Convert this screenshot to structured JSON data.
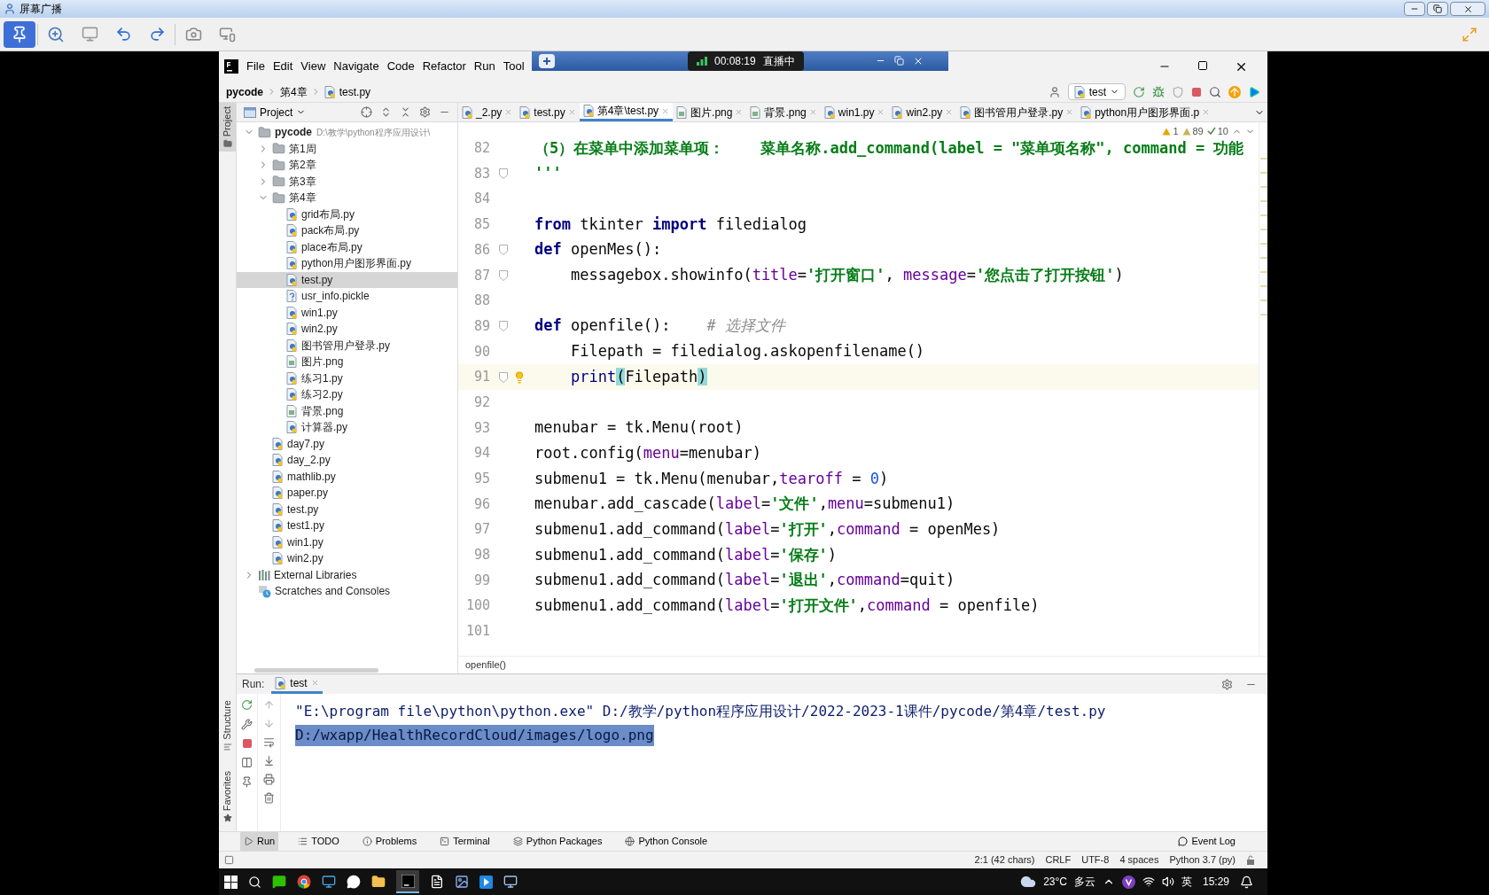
{
  "screen_title": "屏幕广播",
  "broadcast_overlay": {
    "timer": "00:08:19",
    "status": "直播中"
  },
  "ide": {
    "menu": [
      "File",
      "Edit",
      "View",
      "Navigate",
      "Code",
      "Refactor",
      "Run",
      "Tool"
    ],
    "breadcrumbs": [
      "pycode",
      "第4章",
      "test.py"
    ],
    "run_config": "test",
    "side_labels": [
      "Project",
      "Structure",
      "Favorites"
    ],
    "project_panel": {
      "title": "Project",
      "tree": [
        {
          "label": "pycode",
          "kind": "folder",
          "path": "D:\\教学\\python程序应用设计\\",
          "expanded": true,
          "selected": false,
          "children": [
            {
              "label": "第1周",
              "kind": "folder",
              "expanded": false,
              "selected": false
            },
            {
              "label": "第2章",
              "kind": "folder",
              "expanded": false,
              "selected": false
            },
            {
              "label": "第3章",
              "kind": "folder",
              "expanded": false,
              "selected": false
            },
            {
              "label": "第4章",
              "kind": "folder",
              "expanded": true,
              "selected": false,
              "children": [
                {
                  "label": "grid布局.py",
                  "kind": "python",
                  "selected": false
                },
                {
                  "label": "pack布局.py",
                  "kind": "python",
                  "selected": false
                },
                {
                  "label": "place布局.py",
                  "kind": "python",
                  "selected": false
                },
                {
                  "label": "python用户图形界面.py",
                  "kind": "python",
                  "selected": false
                },
                {
                  "label": "test.py",
                  "kind": "python",
                  "selected": true
                },
                {
                  "label": "usr_info.pickle",
                  "kind": "unknown",
                  "selected": false
                },
                {
                  "label": "win1.py",
                  "kind": "python",
                  "selected": false
                },
                {
                  "label": "win2.py",
                  "kind": "python",
                  "selected": false
                },
                {
                  "label": "图书管用户登录.py",
                  "kind": "python",
                  "selected": false
                },
                {
                  "label": "图片.png",
                  "kind": "image",
                  "selected": false
                },
                {
                  "label": "练习1.py",
                  "kind": "python",
                  "selected": false
                },
                {
                  "label": "练习2.py",
                  "kind": "python",
                  "selected": false
                },
                {
                  "label": "背景.png",
                  "kind": "image",
                  "selected": false
                },
                {
                  "label": "计算器.py",
                  "kind": "python",
                  "selected": false
                }
              ]
            },
            {
              "label": "day7.py",
              "kind": "python",
              "selected": false
            },
            {
              "label": "day_2.py",
              "kind": "python",
              "selected": false
            },
            {
              "label": "mathlib.py",
              "kind": "python",
              "selected": false
            },
            {
              "label": "paper.py",
              "kind": "python",
              "selected": false
            },
            {
              "label": "test.py",
              "kind": "python",
              "selected": false
            },
            {
              "label": "test1.py",
              "kind": "python",
              "selected": false
            },
            {
              "label": "win1.py",
              "kind": "python",
              "selected": false
            },
            {
              "label": "win2.py",
              "kind": "python",
              "selected": false
            }
          ]
        },
        {
          "label": "External Libraries",
          "kind": "library",
          "expanded": false,
          "selected": false
        },
        {
          "label": "Scratches and Consoles",
          "kind": "scratches",
          "selected": false
        }
      ]
    },
    "editor_tabs": [
      {
        "label": "_2.py",
        "kind": "python",
        "selected": false
      },
      {
        "label": "test.py",
        "kind": "python",
        "selected": false
      },
      {
        "label": "第4章\\test.py",
        "kind": "python",
        "selected": true
      },
      {
        "label": "图片.png",
        "kind": "image",
        "selected": false
      },
      {
        "label": "背景.png",
        "kind": "image",
        "selected": false
      },
      {
        "label": "win1.py",
        "kind": "python",
        "selected": false
      },
      {
        "label": "win2.py",
        "kind": "python",
        "selected": false
      },
      {
        "label": "图书管用户登录.py",
        "kind": "python",
        "selected": false
      },
      {
        "label": "python用户图形界面.p",
        "kind": "python",
        "selected": false
      }
    ],
    "inspections": [
      {
        "kind": "warning",
        "count": "1"
      },
      {
        "kind": "weak_warning",
        "count": "89"
      },
      {
        "kind": "typo",
        "count": "10"
      }
    ],
    "code_lines": [
      {
        "number": "82",
        "current": false,
        "fold": false,
        "bulb": false,
        "tokens": [
          {
            "kind": "docstring",
            "text": "（5）在菜单中添加菜单项：    菜单名称.add_command(label = \"菜单项名称\", command = 功能"
          }
        ]
      },
      {
        "number": "83",
        "current": false,
        "fold": true,
        "bulb": false,
        "tokens": [
          {
            "kind": "docstring",
            "text": "'''"
          }
        ]
      },
      {
        "number": "84",
        "current": false,
        "fold": false,
        "bulb": false
      },
      {
        "number": "85",
        "current": false,
        "fold": false,
        "bulb": false,
        "tokens": [
          {
            "kind": "keyword",
            "text": "from"
          },
          {
            "kind": "plain",
            "text": " tkinter "
          },
          {
            "kind": "keyword",
            "text": "import"
          },
          {
            "kind": "plain",
            "text": " filedialog"
          }
        ]
      },
      {
        "number": "86",
        "current": false,
        "fold": true,
        "bulb": false,
        "tokens": [
          {
            "kind": "keyword",
            "text": "def"
          },
          {
            "kind": "plain",
            "text": " openMes():"
          }
        ]
      },
      {
        "number": "87",
        "current": false,
        "fold": true,
        "bulb": false,
        "tokens": [
          {
            "kind": "plain",
            "text": "    messagebox.showinfo("
          },
          {
            "kind": "param",
            "text": "title"
          },
          {
            "kind": "plain",
            "text": "="
          },
          {
            "kind": "string",
            "text": "'打开窗口'"
          },
          {
            "kind": "plain",
            "text": ", "
          },
          {
            "kind": "param",
            "text": "message"
          },
          {
            "kind": "plain",
            "text": "="
          },
          {
            "kind": "string",
            "text": "'您点击了打开按钮'"
          },
          {
            "kind": "plain",
            "text": ")"
          }
        ]
      },
      {
        "number": "88",
        "current": false,
        "fold": false,
        "bulb": false
      },
      {
        "number": "89",
        "current": false,
        "fold": true,
        "bulb": false,
        "tokens": [
          {
            "kind": "keyword",
            "text": "def"
          },
          {
            "kind": "plain",
            "text": " openfile():    "
          },
          {
            "kind": "comment",
            "text": "# 选择文件"
          }
        ]
      },
      {
        "number": "90",
        "current": false,
        "fold": false,
        "bulb": false,
        "tokens": [
          {
            "kind": "plain",
            "text": "    Filepath = filedialog.askopenfilename()"
          }
        ]
      },
      {
        "number": "91",
        "current": true,
        "fold": true,
        "bulb": true,
        "tokens": [
          {
            "kind": "builtin",
            "text": "    print"
          },
          {
            "kind": "brace_match",
            "text": "("
          },
          {
            "kind": "plain",
            "text": "Filepath"
          },
          {
            "kind": "brace_match",
            "text": ")"
          }
        ]
      },
      {
        "number": "92",
        "current": false,
        "fold": false,
        "bulb": false
      },
      {
        "number": "93",
        "current": false,
        "fold": false,
        "bulb": false,
        "tokens": [
          {
            "kind": "plain",
            "text": "menubar = tk.Menu(root)"
          }
        ]
      },
      {
        "number": "94",
        "current": false,
        "fold": false,
        "bulb": false,
        "tokens": [
          {
            "kind": "plain",
            "text": "root.config("
          },
          {
            "kind": "param",
            "text": "menu"
          },
          {
            "kind": "plain",
            "text": "=menubar)"
          }
        ]
      },
      {
        "number": "95",
        "current": false,
        "fold": false,
        "bulb": false,
        "tokens": [
          {
            "kind": "plain",
            "text": "submenu1 = tk.Menu(menubar,"
          },
          {
            "kind": "param",
            "text": "tearoff"
          },
          {
            "kind": "plain",
            "text": " = "
          },
          {
            "kind": "number",
            "text": "0"
          },
          {
            "kind": "plain",
            "text": ")"
          }
        ]
      },
      {
        "number": "96",
        "current": false,
        "fold": false,
        "bulb": false,
        "tokens": [
          {
            "kind": "plain",
            "text": "menubar.add_cascade("
          },
          {
            "kind": "param",
            "text": "label"
          },
          {
            "kind": "plain",
            "text": "="
          },
          {
            "kind": "string",
            "text": "'文件'"
          },
          {
            "kind": "plain",
            "text": ","
          },
          {
            "kind": "param",
            "text": "menu"
          },
          {
            "kind": "plain",
            "text": "=submenu1)"
          }
        ]
      },
      {
        "number": "97",
        "current": false,
        "fold": false,
        "bulb": false,
        "tokens": [
          {
            "kind": "plain",
            "text": "submenu1.add_command("
          },
          {
            "kind": "param",
            "text": "label"
          },
          {
            "kind": "plain",
            "text": "="
          },
          {
            "kind": "string",
            "text": "'打开'"
          },
          {
            "kind": "plain",
            "text": ","
          },
          {
            "kind": "param",
            "text": "command"
          },
          {
            "kind": "plain",
            "text": " = openMes)"
          }
        ]
      },
      {
        "number": "98",
        "current": false,
        "fold": false,
        "bulb": false,
        "tokens": [
          {
            "kind": "plain",
            "text": "submenu1.add_command("
          },
          {
            "kind": "param",
            "text": "label"
          },
          {
            "kind": "plain",
            "text": "="
          },
          {
            "kind": "string",
            "text": "'保存'"
          },
          {
            "kind": "plain",
            "text": ")"
          }
        ]
      },
      {
        "number": "99",
        "current": false,
        "fold": false,
        "bulb": false,
        "tokens": [
          {
            "kind": "plain",
            "text": "submenu1.add_command("
          },
          {
            "kind": "param",
            "text": "label"
          },
          {
            "kind": "plain",
            "text": "="
          },
          {
            "kind": "string",
            "text": "'退出'"
          },
          {
            "kind": "plain",
            "text": ","
          },
          {
            "kind": "param",
            "text": "command"
          },
          {
            "kind": "plain",
            "text": "=quit)"
          }
        ]
      },
      {
        "number": "100",
        "current": false,
        "fold": false,
        "bulb": false,
        "tokens": [
          {
            "kind": "plain",
            "text": "submenu1.add_command("
          },
          {
            "kind": "param",
            "text": "label"
          },
          {
            "kind": "plain",
            "text": "="
          },
          {
            "kind": "string",
            "text": "'打开文件'"
          },
          {
            "kind": "plain",
            "text": ","
          },
          {
            "kind": "param",
            "text": "command"
          },
          {
            "kind": "plain",
            "text": " = openfile)"
          }
        ]
      },
      {
        "number": "101",
        "current": false,
        "fold": false,
        "bulb": false
      }
    ],
    "editor_breadcrumb": "openfile()",
    "run_panel": {
      "label": "Run:",
      "tab": "test",
      "output": [
        {
          "text": "\"E:\\program file\\python\\python.exe\" D:/教学/python程序应用设计/2022-2023-1课件/pycode/第4章/test.py",
          "selected": false
        },
        {
          "text": "D:/wxapp/HealthRecordCloud/images/logo.png",
          "selected": true
        }
      ]
    },
    "tool_tabs": [
      {
        "label": "Run",
        "selected": true
      },
      {
        "label": "TODO",
        "selected": false
      },
      {
        "label": "Problems",
        "selected": false
      },
      {
        "label": "Terminal",
        "selected": false
      },
      {
        "label": "Python Packages",
        "selected": false
      },
      {
        "label": "Python Console",
        "selected": false
      }
    ],
    "event_log": "Event Log",
    "status_bar": [
      "2:1 (42 chars)",
      "CRLF",
      "UTF-8",
      "4 spaces",
      "Python 3.7 (py)"
    ]
  },
  "taskbar": {
    "temperature": "23°C",
    "weather": "多云",
    "ime": "英",
    "time": "15:29"
  }
}
